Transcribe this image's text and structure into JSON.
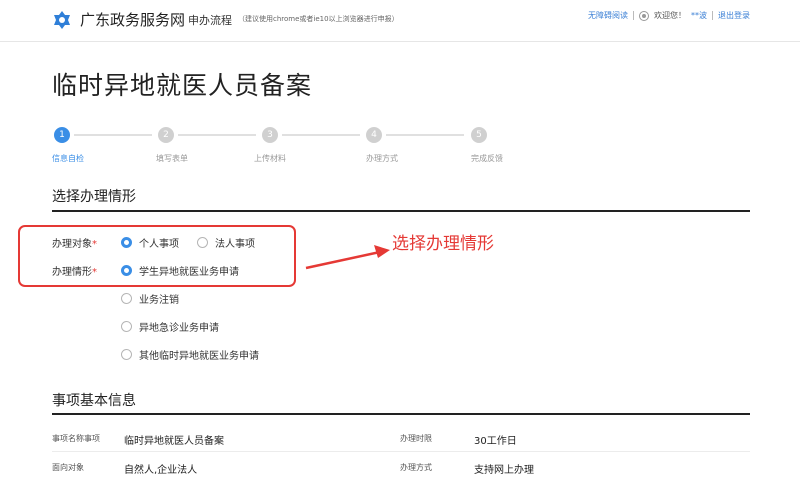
{
  "header": {
    "site_name": "广东政务服务网",
    "section": "申办流程",
    "browser_tip": "（建议使用chrome或者ie10以上浏览器进行申报）",
    "accessibility_link": "无障碍阅读",
    "welcome": "欢迎您！",
    "user_name": "**波",
    "logout": "退出登录"
  },
  "page_title": "临时异地就医人员备案",
  "steps": [
    {
      "number": "1",
      "label": "信息自检",
      "active": true
    },
    {
      "number": "2",
      "label": "填写表单",
      "active": false
    },
    {
      "number": "3",
      "label": "上传材料",
      "active": false
    },
    {
      "number": "4",
      "label": "办理方式",
      "active": false
    },
    {
      "number": "5",
      "label": "完成反馈",
      "active": false
    }
  ],
  "situation_section": {
    "title": "选择办理情形",
    "target_label": "办理对象",
    "required_mark": "*",
    "target_options": [
      {
        "label": "个人事项",
        "checked": true
      },
      {
        "label": "法人事项",
        "checked": false
      }
    ],
    "situation_label": "办理情形",
    "situation_options": [
      {
        "label": "学生异地就医业务申请",
        "checked": true
      },
      {
        "label": "业务注销",
        "checked": false
      },
      {
        "label": "异地急诊业务申请",
        "checked": false
      },
      {
        "label": "其他临时异地就医业务申请",
        "checked": false
      }
    ]
  },
  "annotation": {
    "text": "选择办理情形",
    "color": "#e53935"
  },
  "basic_info": {
    "title": "事项基本信息",
    "rows": [
      {
        "label": "事项名称事项",
        "value": "临时异地就医人员备案",
        "label2": "办理时限",
        "value2": "30工作日"
      },
      {
        "label": "面向对象",
        "value": "自然人,企业法人",
        "label2": "办理方式",
        "value2": "支持网上办理"
      }
    ]
  },
  "colors": {
    "accent": "#3a8ee6",
    "step_inactive": "#d0d0d0",
    "annotation": "#e53935"
  }
}
